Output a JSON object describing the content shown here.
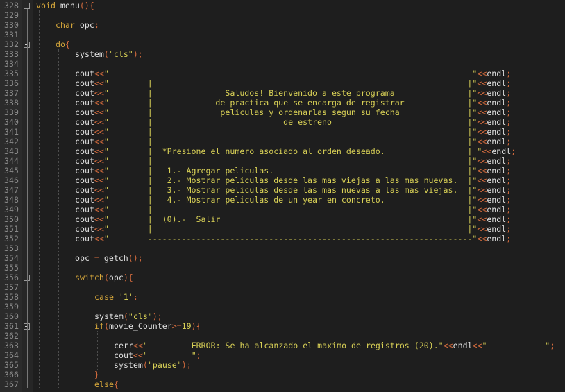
{
  "editor": {
    "colors": {
      "background": "#1e1e1e",
      "gutter": "#2b2b2b",
      "line_number": "#8b8b8b",
      "keyword": "#d7a83b",
      "identifier": "#e0e0e0",
      "punctuation": "#d76d3e",
      "string": "#d8d056"
    },
    "lines": [
      {
        "n": "328",
        "indent": 0,
        "tokens": [
          {
            "t": "kw",
            "v": "void"
          },
          {
            "t": "id",
            "v": " menu"
          },
          {
            "t": "pn",
            "v": "(){"
          }
        ]
      },
      {
        "n": "329",
        "indent": 0,
        "tokens": []
      },
      {
        "n": "330",
        "indent": 1,
        "tokens": [
          {
            "t": "kw",
            "v": "char"
          },
          {
            "t": "id",
            "v": " opc"
          },
          {
            "t": "pn",
            "v": ";"
          }
        ]
      },
      {
        "n": "331",
        "indent": 0,
        "tokens": []
      },
      {
        "n": "332",
        "indent": 1,
        "tokens": [
          {
            "t": "kw",
            "v": "do"
          },
          {
            "t": "pn",
            "v": "{"
          }
        ]
      },
      {
        "n": "333",
        "indent": 2,
        "tokens": [
          {
            "t": "id",
            "v": "system"
          },
          {
            "t": "pn",
            "v": "("
          },
          {
            "t": "str",
            "v": "\"cls\""
          },
          {
            "t": "pn",
            "v": ");"
          }
        ]
      },
      {
        "n": "334",
        "indent": 0,
        "tokens": []
      },
      {
        "n": "335",
        "indent": 2,
        "tokens": [
          {
            "t": "id",
            "v": "cout"
          },
          {
            "t": "op",
            "v": "<<"
          },
          {
            "t": "str",
            "v": "\"        ___________________________________________________________________\""
          },
          {
            "t": "op",
            "v": "<<"
          },
          {
            "t": "id",
            "v": "endl"
          },
          {
            "t": "pn",
            "v": ";"
          }
        ]
      },
      {
        "n": "336",
        "indent": 2,
        "tokens": [
          {
            "t": "id",
            "v": "cout"
          },
          {
            "t": "op",
            "v": "<<"
          },
          {
            "t": "str",
            "v": "\"        |                                                                 |\""
          },
          {
            "t": "op",
            "v": "<<"
          },
          {
            "t": "id",
            "v": "endl"
          },
          {
            "t": "pn",
            "v": ";"
          }
        ]
      },
      {
        "n": "337",
        "indent": 2,
        "tokens": [
          {
            "t": "id",
            "v": "cout"
          },
          {
            "t": "op",
            "v": "<<"
          },
          {
            "t": "str",
            "v": "\"        |               Saludos! Bienvenido a este programa               |\""
          },
          {
            "t": "op",
            "v": "<<"
          },
          {
            "t": "id",
            "v": "endl"
          },
          {
            "t": "pn",
            "v": ";"
          }
        ]
      },
      {
        "n": "338",
        "indent": 2,
        "tokens": [
          {
            "t": "id",
            "v": "cout"
          },
          {
            "t": "op",
            "v": "<<"
          },
          {
            "t": "str",
            "v": "\"        |             de practica que se encarga de registrar             |\""
          },
          {
            "t": "op",
            "v": "<<"
          },
          {
            "t": "id",
            "v": "endl"
          },
          {
            "t": "pn",
            "v": ";"
          }
        ]
      },
      {
        "n": "339",
        "indent": 2,
        "tokens": [
          {
            "t": "id",
            "v": "cout"
          },
          {
            "t": "op",
            "v": "<<"
          },
          {
            "t": "str",
            "v": "\"        |              peliculas y ordenarlas segun su fecha              |\""
          },
          {
            "t": "op",
            "v": "<<"
          },
          {
            "t": "id",
            "v": "endl"
          },
          {
            "t": "pn",
            "v": ";"
          }
        ]
      },
      {
        "n": "340",
        "indent": 2,
        "tokens": [
          {
            "t": "id",
            "v": "cout"
          },
          {
            "t": "op",
            "v": "<<"
          },
          {
            "t": "str",
            "v": "\"        |                           de estreno                            |\""
          },
          {
            "t": "op",
            "v": "<<"
          },
          {
            "t": "id",
            "v": "endl"
          },
          {
            "t": "pn",
            "v": ";"
          }
        ]
      },
      {
        "n": "341",
        "indent": 2,
        "tokens": [
          {
            "t": "id",
            "v": "cout"
          },
          {
            "t": "op",
            "v": "<<"
          },
          {
            "t": "str",
            "v": "\"        |                                                                 |\""
          },
          {
            "t": "op",
            "v": "<<"
          },
          {
            "t": "id",
            "v": "endl"
          },
          {
            "t": "pn",
            "v": ";"
          }
        ]
      },
      {
        "n": "342",
        "indent": 2,
        "tokens": [
          {
            "t": "id",
            "v": "cout"
          },
          {
            "t": "op",
            "v": "<<"
          },
          {
            "t": "str",
            "v": "\"        |                                                                 |\""
          },
          {
            "t": "op",
            "v": "<<"
          },
          {
            "t": "id",
            "v": "endl"
          },
          {
            "t": "pn",
            "v": ";"
          }
        ]
      },
      {
        "n": "343",
        "indent": 2,
        "tokens": [
          {
            "t": "id",
            "v": "cout"
          },
          {
            "t": "op",
            "v": "<<"
          },
          {
            "t": "str",
            "v": "\"        |  *Presione el numero asociado al orden deseado.                 | \""
          },
          {
            "t": "op",
            "v": "<<"
          },
          {
            "t": "id",
            "v": "endl"
          },
          {
            "t": "pn",
            "v": ";"
          }
        ]
      },
      {
        "n": "344",
        "indent": 2,
        "tokens": [
          {
            "t": "id",
            "v": "cout"
          },
          {
            "t": "op",
            "v": "<<"
          },
          {
            "t": "str",
            "v": "\"        |                                                                 |\""
          },
          {
            "t": "op",
            "v": "<<"
          },
          {
            "t": "id",
            "v": "endl"
          },
          {
            "t": "pn",
            "v": ";"
          }
        ]
      },
      {
        "n": "345",
        "indent": 2,
        "tokens": [
          {
            "t": "id",
            "v": "cout"
          },
          {
            "t": "op",
            "v": "<<"
          },
          {
            "t": "str",
            "v": "\"        |   1.- Agregar peliculas.                                        |\""
          },
          {
            "t": "op",
            "v": "<<"
          },
          {
            "t": "id",
            "v": "endl"
          },
          {
            "t": "pn",
            "v": ";"
          }
        ]
      },
      {
        "n": "346",
        "indent": 2,
        "tokens": [
          {
            "t": "id",
            "v": "cout"
          },
          {
            "t": "op",
            "v": "<<"
          },
          {
            "t": "str",
            "v": "\"        |   2.- Mostrar peliculas desde las mas viejas a las mas nuevas.  |\""
          },
          {
            "t": "op",
            "v": "<<"
          },
          {
            "t": "id",
            "v": "endl"
          },
          {
            "t": "pn",
            "v": ";"
          }
        ]
      },
      {
        "n": "347",
        "indent": 2,
        "tokens": [
          {
            "t": "id",
            "v": "cout"
          },
          {
            "t": "op",
            "v": "<<"
          },
          {
            "t": "str",
            "v": "\"        |   3.- Mostrar peliculas desde las mas nuevas a las mas viejas.  |\""
          },
          {
            "t": "op",
            "v": "<<"
          },
          {
            "t": "id",
            "v": "endl"
          },
          {
            "t": "pn",
            "v": ";"
          }
        ]
      },
      {
        "n": "348",
        "indent": 2,
        "tokens": [
          {
            "t": "id",
            "v": "cout"
          },
          {
            "t": "op",
            "v": "<<"
          },
          {
            "t": "str",
            "v": "\"        |   4.- Mostrar peliculas de un year en concreto.                 |\""
          },
          {
            "t": "op",
            "v": "<<"
          },
          {
            "t": "id",
            "v": "endl"
          },
          {
            "t": "pn",
            "v": ";"
          }
        ]
      },
      {
        "n": "349",
        "indent": 2,
        "tokens": [
          {
            "t": "id",
            "v": "cout"
          },
          {
            "t": "op",
            "v": "<<"
          },
          {
            "t": "str",
            "v": "\"        |                                                                 |\""
          },
          {
            "t": "op",
            "v": "<<"
          },
          {
            "t": "id",
            "v": "endl"
          },
          {
            "t": "pn",
            "v": ";"
          }
        ]
      },
      {
        "n": "350",
        "indent": 2,
        "tokens": [
          {
            "t": "id",
            "v": "cout"
          },
          {
            "t": "op",
            "v": "<<"
          },
          {
            "t": "str",
            "v": "\"        |  (0).-  Salir                                                   |\""
          },
          {
            "t": "op",
            "v": "<<"
          },
          {
            "t": "id",
            "v": "endl"
          },
          {
            "t": "pn",
            "v": ";"
          }
        ]
      },
      {
        "n": "351",
        "indent": 2,
        "tokens": [
          {
            "t": "id",
            "v": "cout"
          },
          {
            "t": "op",
            "v": "<<"
          },
          {
            "t": "str",
            "v": "\"        |                                                                 |\""
          },
          {
            "t": "op",
            "v": "<<"
          },
          {
            "t": "id",
            "v": "endl"
          },
          {
            "t": "pn",
            "v": ";"
          }
        ]
      },
      {
        "n": "352",
        "indent": 2,
        "tokens": [
          {
            "t": "id",
            "v": "cout"
          },
          {
            "t": "op",
            "v": "<<"
          },
          {
            "t": "str",
            "v": "\"        -------------------------------------------------------------------\""
          },
          {
            "t": "op",
            "v": "<<"
          },
          {
            "t": "id",
            "v": "endl"
          },
          {
            "t": "pn",
            "v": ";"
          }
        ]
      },
      {
        "n": "353",
        "indent": 0,
        "tokens": []
      },
      {
        "n": "354",
        "indent": 2,
        "tokens": [
          {
            "t": "id",
            "v": "opc "
          },
          {
            "t": "op",
            "v": "="
          },
          {
            "t": "id",
            "v": " getch"
          },
          {
            "t": "pn",
            "v": "();"
          }
        ]
      },
      {
        "n": "355",
        "indent": 0,
        "tokens": []
      },
      {
        "n": "356",
        "indent": 2,
        "tokens": [
          {
            "t": "kw",
            "v": "switch"
          },
          {
            "t": "pn",
            "v": "("
          },
          {
            "t": "id",
            "v": "opc"
          },
          {
            "t": "pn",
            "v": "){"
          }
        ]
      },
      {
        "n": "357",
        "indent": 0,
        "tokens": []
      },
      {
        "n": "358",
        "indent": 3,
        "tokens": [
          {
            "t": "kw",
            "v": "case"
          },
          {
            "t": "id",
            "v": " "
          },
          {
            "t": "str",
            "v": "'1'"
          },
          {
            "t": "pn",
            "v": ":"
          }
        ]
      },
      {
        "n": "359",
        "indent": 0,
        "tokens": []
      },
      {
        "n": "360",
        "indent": 3,
        "tokens": [
          {
            "t": "id",
            "v": "system"
          },
          {
            "t": "pn",
            "v": "("
          },
          {
            "t": "str",
            "v": "\"cls\""
          },
          {
            "t": "pn",
            "v": ");"
          }
        ]
      },
      {
        "n": "361",
        "indent": 3,
        "tokens": [
          {
            "t": "kw",
            "v": "if"
          },
          {
            "t": "pn",
            "v": "("
          },
          {
            "t": "id",
            "v": "movie_Counter"
          },
          {
            "t": "op",
            "v": ">="
          },
          {
            "t": "num",
            "v": "19"
          },
          {
            "t": "pn",
            "v": "){"
          }
        ]
      },
      {
        "n": "362",
        "indent": 0,
        "tokens": []
      },
      {
        "n": "363",
        "indent": 4,
        "tokens": [
          {
            "t": "id",
            "v": "cerr"
          },
          {
            "t": "op",
            "v": "<<"
          },
          {
            "t": "str",
            "v": "\"         ERROR: Se ha alcanzado el maximo de registros (20).\""
          },
          {
            "t": "op",
            "v": "<<"
          },
          {
            "t": "id",
            "v": "endl"
          },
          {
            "t": "op",
            "v": "<<"
          },
          {
            "t": "str",
            "v": "\"            \""
          },
          {
            "t": "pn",
            "v": ";"
          }
        ]
      },
      {
        "n": "364",
        "indent": 4,
        "tokens": [
          {
            "t": "id",
            "v": "cout"
          },
          {
            "t": "op",
            "v": "<<"
          },
          {
            "t": "str",
            "v": "\"         \""
          },
          {
            "t": "pn",
            "v": ";"
          }
        ]
      },
      {
        "n": "365",
        "indent": 4,
        "tokens": [
          {
            "t": "id",
            "v": "system"
          },
          {
            "t": "pn",
            "v": "("
          },
          {
            "t": "str",
            "v": "\"pause\""
          },
          {
            "t": "pn",
            "v": ");"
          }
        ]
      },
      {
        "n": "366",
        "indent": 3,
        "tokens": [
          {
            "t": "pn",
            "v": "}"
          }
        ]
      },
      {
        "n": "367",
        "indent": 3,
        "tokens": [
          {
            "t": "kw",
            "v": "else"
          },
          {
            "t": "pn",
            "v": "{"
          }
        ]
      }
    ]
  }
}
